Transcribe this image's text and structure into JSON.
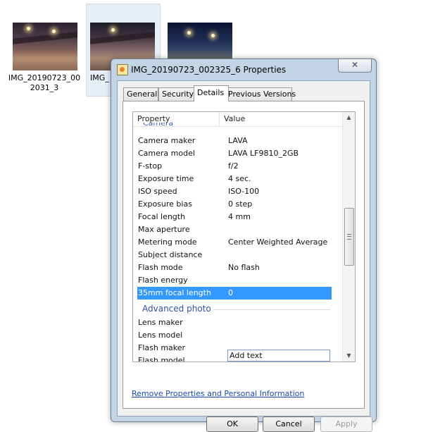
{
  "explorer": {
    "thumbnails": [
      {
        "label": "IMG_20190723_002031_3"
      },
      {
        "label": "IMG_"
      },
      {
        "label": ""
      }
    ],
    "thumb1_line1": "IMG_20190723_00",
    "thumb1_line2": "2031_3"
  },
  "dialog": {
    "title": "IMG_20190723_002325_6 Properties",
    "close_glyph": "✕",
    "tabs": [
      {
        "label": "General",
        "active": false
      },
      {
        "label": "Security",
        "active": false
      },
      {
        "label": "Details",
        "active": true
      },
      {
        "label": "Previous Versions",
        "active": false
      }
    ],
    "list": {
      "columns": [
        "Property",
        "Value"
      ],
      "cut_heading": "Camera",
      "rows": [
        {
          "property": "Camera maker",
          "value": "LAVA"
        },
        {
          "property": "Camera model",
          "value": "LAVA LF9810_2GB"
        },
        {
          "property": "F-stop",
          "value": "f/2"
        },
        {
          "property": "Exposure time",
          "value": "4 sec."
        },
        {
          "property": "ISO speed",
          "value": "ISO-100"
        },
        {
          "property": "Exposure bias",
          "value": "0 step"
        },
        {
          "property": "Focal length",
          "value": "4 mm"
        },
        {
          "property": "Max aperture",
          "value": ""
        },
        {
          "property": "Metering mode",
          "value": "Center Weighted Average"
        },
        {
          "property": "Subject distance",
          "value": ""
        },
        {
          "property": "Flash mode",
          "value": "No flash"
        },
        {
          "property": "Flash energy",
          "value": ""
        },
        {
          "property": "35mm focal length",
          "value": "0",
          "selected": true
        }
      ],
      "group_title": "Advanced photo",
      "advanced_rows": [
        {
          "property": "Lens maker",
          "value": ""
        },
        {
          "property": "Lens model",
          "value": ""
        },
        {
          "property": "Flash maker",
          "value": "Add text"
        },
        {
          "property": "Flash model",
          "value": ""
        }
      ]
    },
    "remove_link": "Remove Properties and Personal Information",
    "buttons": {
      "ok": "OK",
      "cancel": "Cancel",
      "apply": "Apply"
    },
    "scroll_up_glyph": "▲",
    "scroll_down_glyph": "▼"
  }
}
